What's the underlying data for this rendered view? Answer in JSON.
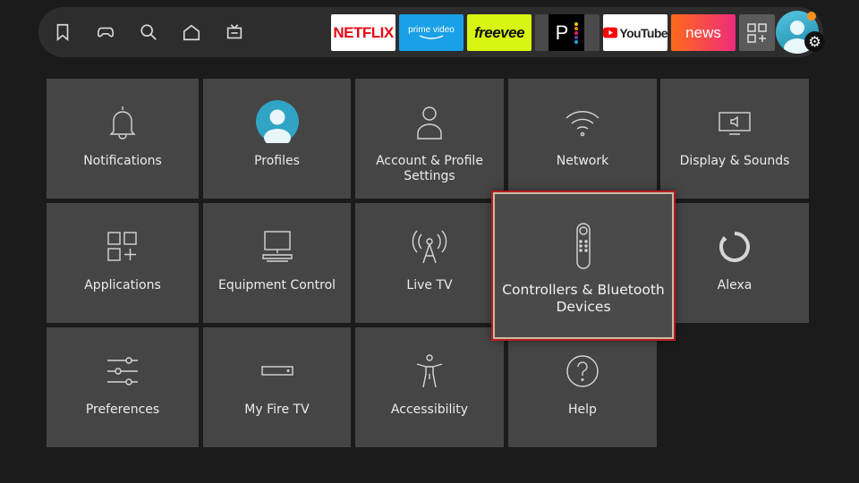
{
  "nav": {
    "icons": [
      "bookmark-icon",
      "gamepad-icon",
      "search-icon",
      "home-icon",
      "live-tv-icon"
    ]
  },
  "apps": {
    "netflix": "NETFLIX",
    "prime_top": "prime video",
    "freevee": "freevee",
    "peacock": "P",
    "youtube": "YouTube",
    "news": "news"
  },
  "settings": {
    "notifications": "Notifications",
    "profiles": "Profiles",
    "account": "Account & Profile Settings",
    "network": "Network",
    "display": "Display & Sounds",
    "applications": "Applications",
    "equipment": "Equipment Control",
    "livetv": "Live TV",
    "controllers": "Controllers & Bluetooth Devices",
    "alexa": "Alexa",
    "preferences": "Preferences",
    "myfiretv": "My Fire TV",
    "accessibility": "Accessibility",
    "help": "Help"
  },
  "colors": {
    "background": "#1b1b1b",
    "tile": "#454545",
    "focus_border": "#b51d1d",
    "netflix_red": "#e50914",
    "prime_blue": "#1aa0e6",
    "freevee_yellow": "#d8f511",
    "news_gradient_start": "#ff6a1a",
    "news_gradient_end": "#ee2c7c",
    "notification_dot": "#f5901e"
  }
}
